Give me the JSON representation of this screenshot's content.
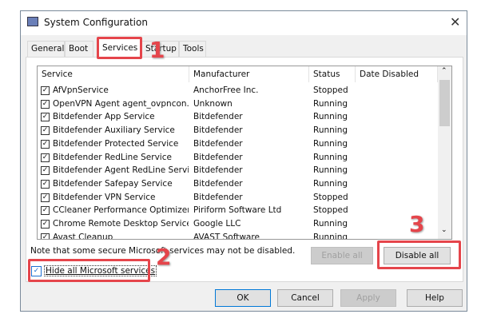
{
  "window": {
    "title": "System Configuration",
    "close_label": "✕"
  },
  "tabs": [
    {
      "label": "General"
    },
    {
      "label": "Boot"
    },
    {
      "label": "Services",
      "active": true
    },
    {
      "label": "Startup"
    },
    {
      "label": "Tools"
    }
  ],
  "columns": [
    "Service",
    "Manufacturer",
    "Status",
    "Date Disabled"
  ],
  "services": [
    {
      "name": "AfVpnService",
      "manufacturer": "AnchorFree Inc.",
      "status": "Stopped",
      "date_disabled": "",
      "checked": true
    },
    {
      "name": "OpenVPN Agent agent_ovpncon...",
      "manufacturer": "Unknown",
      "status": "Running",
      "date_disabled": "",
      "checked": true
    },
    {
      "name": "Bitdefender App Service",
      "manufacturer": "Bitdefender",
      "status": "Running",
      "date_disabled": "",
      "checked": true
    },
    {
      "name": "Bitdefender Auxiliary Service",
      "manufacturer": "Bitdefender",
      "status": "Running",
      "date_disabled": "",
      "checked": true
    },
    {
      "name": "Bitdefender Protected Service",
      "manufacturer": "Bitdefender",
      "status": "Running",
      "date_disabled": "",
      "checked": true
    },
    {
      "name": "Bitdefender RedLine Service",
      "manufacturer": "Bitdefender",
      "status": "Running",
      "date_disabled": "",
      "checked": true
    },
    {
      "name": "Bitdefender Agent RedLine Service",
      "manufacturer": "Bitdefender",
      "status": "Running",
      "date_disabled": "",
      "checked": true
    },
    {
      "name": "Bitdefender Safepay Service",
      "manufacturer": "Bitdefender",
      "status": "Running",
      "date_disabled": "",
      "checked": true
    },
    {
      "name": "Bitdefender VPN Service",
      "manufacturer": "Bitdefender",
      "status": "Stopped",
      "date_disabled": "",
      "checked": true
    },
    {
      "name": "CCleaner Performance Optimizer...",
      "manufacturer": "Piriform Software Ltd",
      "status": "Stopped",
      "date_disabled": "",
      "checked": true
    },
    {
      "name": "Chrome Remote Desktop Service",
      "manufacturer": "Google LLC",
      "status": "Running",
      "date_disabled": "",
      "checked": true
    },
    {
      "name": "Avast Cleanup",
      "manufacturer": "AVAST Software",
      "status": "Running",
      "date_disabled": "",
      "checked": true
    }
  ],
  "note": "Note that some secure Microsoft services may not be disabled.",
  "hide_ms": {
    "label": "Hide all Microsoft services",
    "checked": true
  },
  "buttons": {
    "enable_all": "Enable all",
    "disable_all": "Disable all",
    "ok": "OK",
    "cancel": "Cancel",
    "apply": "Apply",
    "help": "Help"
  },
  "annotations": [
    "1",
    "2",
    "3"
  ],
  "colors": {
    "annotation": "#e5454b",
    "default_button_border": "#0078d7"
  }
}
